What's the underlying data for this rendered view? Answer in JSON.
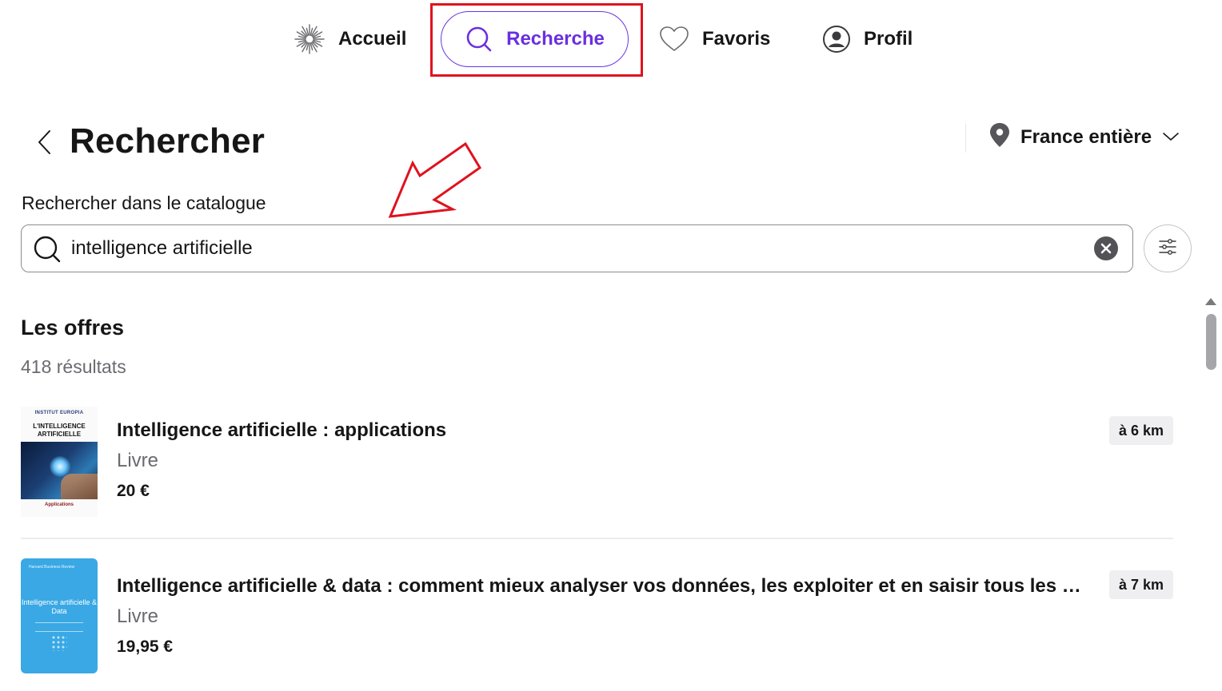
{
  "nav": {
    "items": [
      {
        "label": "Accueil",
        "icon": "sunburst-icon"
      },
      {
        "label": "Recherche",
        "icon": "search-icon",
        "active": true
      },
      {
        "label": "Favoris",
        "icon": "heart-icon"
      },
      {
        "label": "Profil",
        "icon": "user-circle-icon"
      }
    ],
    "active_color": "#6b2fe0"
  },
  "header": {
    "title": "Rechercher",
    "location_label": "France entière"
  },
  "search": {
    "label": "Rechercher dans le catalogue",
    "value": "intelligence artificielle"
  },
  "results": {
    "section_title": "Les offres",
    "count_text": "418 résultats",
    "offers": [
      {
        "title": "Intelligence artificielle : applications",
        "type": "Livre",
        "price": "20 €",
        "distance": "à 6 km",
        "cover": {
          "publisher": "INSTITUT EUROPIA",
          "title": "L'INTELLIGENCE ARTIFICIELLE",
          "subtitle": "Applications"
        }
      },
      {
        "title": "Intelligence artificielle & data : comment mieux analyser vos données, les exploiter et en saisir tous les bénéfices",
        "type": "Livre",
        "price": "19,95 €",
        "distance": "à 7 km",
        "cover": {
          "publisher": "Harvard Business Review",
          "title": "Intelligence artificielle & Data"
        }
      }
    ]
  },
  "annotation_colors": {
    "highlight": "#e0121e"
  }
}
